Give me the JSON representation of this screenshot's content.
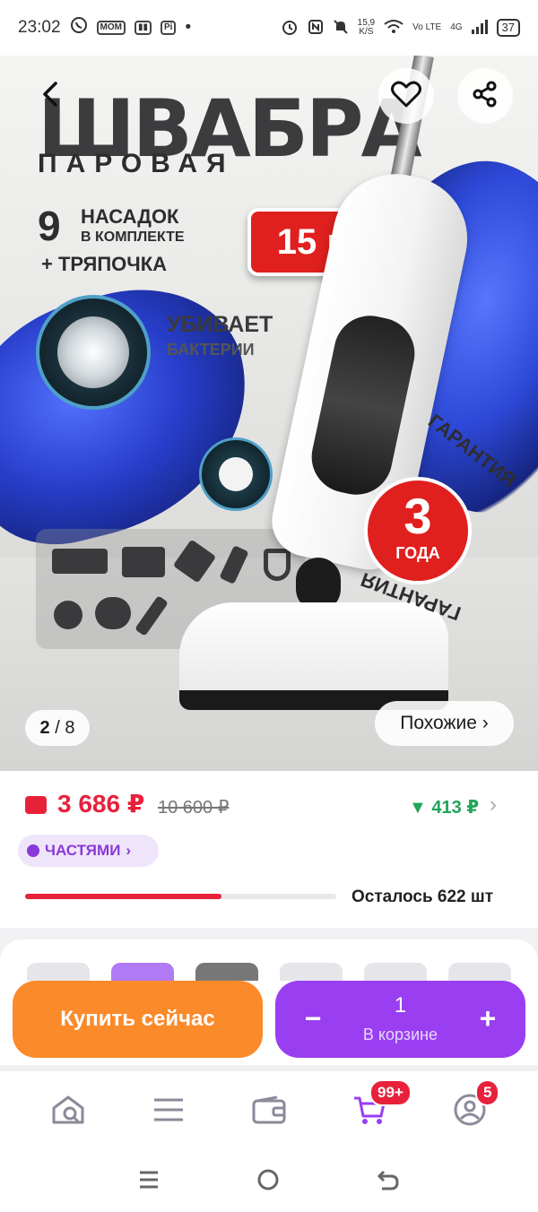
{
  "status_bar": {
    "time": "23:02",
    "app_icons": [
      "whatsapp-icon",
      "momlife-icon",
      "mailru-icon",
      "pi-icon"
    ],
    "net_speed_value": "15,9",
    "net_speed_unit": "K/S",
    "network": "Vo LTE",
    "signal": "4G",
    "battery": "37"
  },
  "hero": {
    "title": "ШВАБРА",
    "subtitle": "ПАРОВАЯ",
    "feature_count": "9",
    "feature_line1": "НАСАДОК",
    "feature_line2": "В КОМПЛЕКТЕ",
    "feature_extra": "+ ТРЯПОЧКА",
    "badge": "15 в1",
    "bacteria_line1": "УБИВАЕТ",
    "bacteria_line2": "БАКТЕРИИ",
    "warranty_num": "3",
    "warranty_years": "ГОДА",
    "warranty_arc": "ГАРАНТИЯ",
    "page_current": "2",
    "page_total": "8",
    "similar_label": "Похожие ›",
    "colors": {
      "accent_red": "#e0201e",
      "fabric_blue": "#1d35c9"
    }
  },
  "price": {
    "current": "3 686 ₽",
    "old": "10 600 ₽",
    "cashback": "▼ 413 ₽",
    "installments_label": "ЧАСТЯМИ",
    "stock_progress": 0.63,
    "stock_text": "Осталось 622 шт",
    "colors": {
      "price_red": "#e8213b",
      "cashback_green": "#22a55a",
      "installments_purple": "#8a39d8"
    }
  },
  "actions": {
    "buy_now": "Купить сейчас",
    "qty_minus": "−",
    "qty_plus": "+",
    "quantity": "1",
    "in_cart_label": "В корзине",
    "colors": {
      "buy_orange": "#fb8a2a",
      "cart_purple": "#9a3ef2"
    }
  },
  "bottom_nav": {
    "items": [
      "home-icon",
      "catalog-icon",
      "wallet-icon",
      "cart-icon",
      "profile-icon"
    ],
    "cart_badge": "99+",
    "profile_badge": "5"
  }
}
